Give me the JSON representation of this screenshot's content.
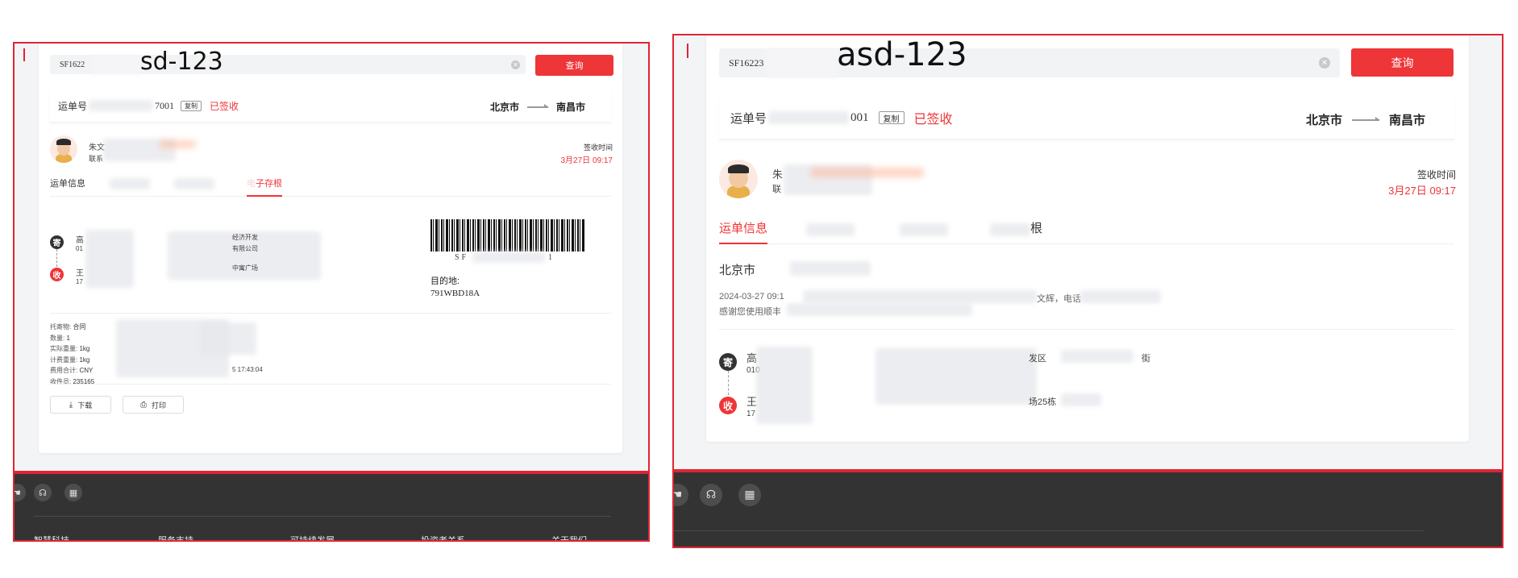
{
  "left": {
    "search": {
      "value": "SF1622",
      "clear_icon": "close-icon",
      "overlay": "sd-123",
      "button": "查询"
    },
    "waybill": {
      "label": "运单号",
      "tail": "7001",
      "copy": "复制",
      "status": "已签收",
      "from": "北京市",
      "to": "南昌市"
    },
    "courier": {
      "name": "朱文",
      "contact": "联系",
      "sign_label": "签收时间",
      "sign_time": "3月27日 09:17"
    },
    "tabs": [
      "运单信息",
      "子存根"
    ],
    "sender": {
      "badge": "寄",
      "name": "高",
      "phone": "01",
      "addr_tail": "经济开发",
      "addr_tail2": "有限公司"
    },
    "receiver": {
      "badge": "收",
      "name": "王",
      "phone": "17",
      "addr_tail": "中寓广场"
    },
    "barcode": {
      "code_prefix": "SF",
      "code_suffix": "1",
      "dest_label": "目的地:",
      "dest_code": "791WBD18A"
    },
    "details": {
      "labels": [
        "托寄物:",
        "数量:",
        "实际重量:",
        "计费重量:",
        "费用合计:",
        "收件员:"
      ],
      "values": [
        "合同",
        "1",
        "1kg",
        "1kg",
        "CNY",
        "235165"
      ],
      "time_tail": "5 17:43:04"
    },
    "actions": {
      "download": "下载",
      "download_icon": "download-icon",
      "print": "打印",
      "print_icon": "printer-icon"
    },
    "footer": {
      "icons": [
        "hand-icon",
        "headset-icon",
        "qrcode-icon"
      ],
      "links": [
        "智慧科技",
        "服务支持",
        "可持续发展",
        "投资者关系",
        "关于我们"
      ]
    }
  },
  "right": {
    "search": {
      "value": "SF16223",
      "clear_icon": "close-icon",
      "overlay": "asd-123",
      "button": "查询"
    },
    "waybill": {
      "label": "运单号",
      "tail": "001",
      "copy": "复制",
      "status": "已签收",
      "from": "北京市",
      "to": "南昌市"
    },
    "courier": {
      "name": "朱",
      "contact": "联",
      "sign_label": "签收时间",
      "sign_time": "3月27日 09:17"
    },
    "tabs": [
      "运单信息",
      "根"
    ],
    "trace": {
      "city": "北京市",
      "line1_head": "2024-03-27 09:1",
      "line1_tail": "快件已到达，欢迎使用，如有任何问题，请联系",
      "line1_tail_visible": "文辉，电话",
      "line2_head": "感谢您使用顺丰"
    },
    "sender": {
      "badge": "寄",
      "name": "高",
      "phone": "010",
      "addr_tail": "发区",
      "addr_tail2": "街"
    },
    "receiver": {
      "badge": "收",
      "name": "王",
      "phone": "17",
      "addr_tail": "场25栋"
    },
    "footer": {
      "icons": [
        "hand-icon",
        "headset-icon",
        "qrcode-icon"
      ]
    }
  },
  "colors": {
    "accent": "#ee3537",
    "frame": "#e02433",
    "footer_bg": "#333333"
  }
}
